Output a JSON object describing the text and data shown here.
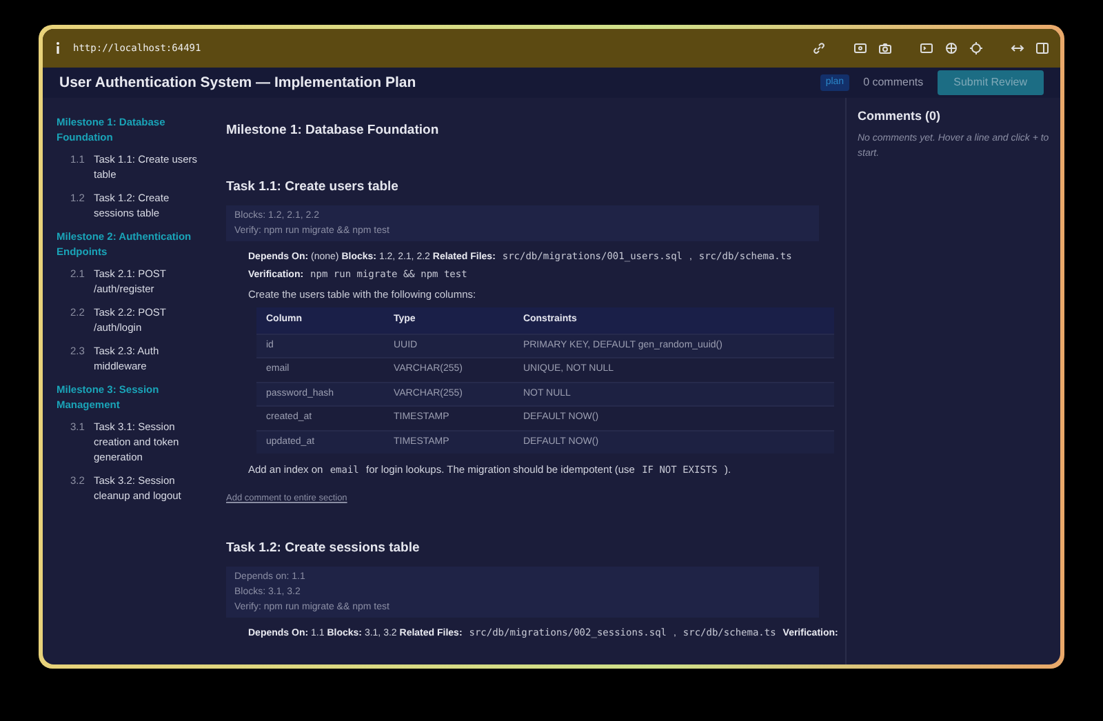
{
  "browser": {
    "url": "http://localhost:64491"
  },
  "header": {
    "title": "User Authentication System — Implementation Plan",
    "badge": "plan",
    "comment_count": "0 comments",
    "submit_button": "Submit Review"
  },
  "sidebar": {
    "milestones": [
      {
        "title": "Milestone 1: Database Foundation",
        "tasks": [
          {
            "number": "1.1",
            "label": "Task 1.1: Create users table"
          },
          {
            "number": "1.2",
            "label": "Task 1.2: Create sessions table"
          }
        ]
      },
      {
        "title": "Milestone 2: Authentication Endpoints",
        "tasks": [
          {
            "number": "2.1",
            "label": "Task 2.1: POST /auth/register"
          },
          {
            "number": "2.2",
            "label": "Task 2.2: POST /auth/login"
          },
          {
            "number": "2.3",
            "label": "Task 2.3: Auth middleware"
          }
        ]
      },
      {
        "title": "Milestone 3: Session Management",
        "tasks": [
          {
            "number": "3.1",
            "label": "Task 3.1: Session creation and token generation"
          },
          {
            "number": "3.2",
            "label": "Task 3.2: Session cleanup and logout"
          }
        ]
      }
    ]
  },
  "content": {
    "milestone_heading": "Milestone 1: Database Foundation",
    "tasks": [
      {
        "heading": "Task 1.1: Create users table",
        "meta": [
          "Blocks: 1.2, 2.1, 2.2",
          "Verify: npm run migrate && npm test"
        ],
        "details": [
          [
            {
              "kind": "label",
              "text": "Depends On:"
            },
            {
              "kind": "text",
              "text": "(none)"
            },
            {
              "kind": "label",
              "text": "Blocks:"
            },
            {
              "kind": "text",
              "text": "1.2, 2.1, 2.2"
            },
            {
              "kind": "label",
              "text": "Related Files:"
            },
            {
              "kind": "code",
              "text": "src/db/migrations/001_users.sql"
            },
            {
              "kind": "text",
              "text": ","
            },
            {
              "kind": "code",
              "text": "src/db/schema.ts"
            }
          ],
          [
            {
              "kind": "label",
              "text": "Verification:"
            },
            {
              "kind": "code",
              "text": "npm run migrate && npm test"
            }
          ]
        ],
        "intro": "Create the users table with the following columns:",
        "table": {
          "columns": [
            "Column",
            "Type",
            "Constraints"
          ],
          "rows": [
            [
              "id",
              "UUID",
              "PRIMARY KEY, DEFAULT gen_random_uuid()"
            ],
            [
              "email",
              "VARCHAR(255)",
              "UNIQUE, NOT NULL"
            ],
            [
              "password_hash",
              "VARCHAR(255)",
              "NOT NULL"
            ],
            [
              "created_at",
              "TIMESTAMP",
              "DEFAULT NOW()"
            ],
            [
              "updated_at",
              "TIMESTAMP",
              "DEFAULT NOW()"
            ]
          ]
        },
        "note": [
          {
            "kind": "text",
            "text": "Add an index on"
          },
          {
            "kind": "code",
            "text": "email"
          },
          {
            "kind": "text",
            "text": "for login lookups. The migration should be idempotent (use"
          },
          {
            "kind": "code",
            "text": "IF NOT EXISTS"
          },
          {
            "kind": "text",
            "text": ")."
          }
        ],
        "comment_link": "Add comment to entire section"
      },
      {
        "heading": "Task 1.2: Create sessions table",
        "meta": [
          "Depends on: 1.1",
          "Blocks: 3.1, 3.2",
          "Verify: npm run migrate && npm test"
        ],
        "details": [
          [
            {
              "kind": "label",
              "text": "Depends On:"
            },
            {
              "kind": "text",
              "text": "1.1"
            },
            {
              "kind": "label",
              "text": "Blocks:"
            },
            {
              "kind": "text",
              "text": "3.1, 3.2"
            },
            {
              "kind": "label",
              "text": "Related Files:"
            },
            {
              "kind": "code",
              "text": "src/db/migrations/002_sessions.sql"
            },
            {
              "kind": "text",
              "text": ","
            },
            {
              "kind": "code",
              "text": "src/db/schema.ts"
            },
            {
              "kind": "label",
              "text": "Verification:"
            }
          ]
        ]
      }
    ]
  },
  "comments": {
    "title": "Comments (0)",
    "empty_text": "No comments yet. Hover a line and click + to start."
  }
}
